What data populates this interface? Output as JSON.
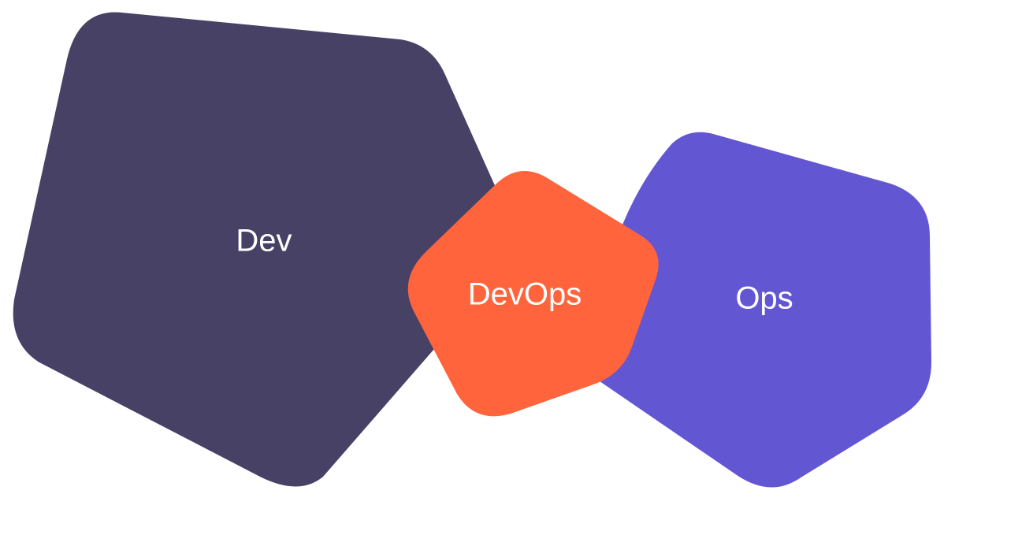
{
  "colors": {
    "background": "#ffffff",
    "dev": "#474166",
    "ops": "#6356d3",
    "devops": "#ff643c",
    "label": "#ffffff"
  },
  "shapes": {
    "dev": {
      "label": "Dev"
    },
    "ops": {
      "label": "Ops"
    },
    "devops": {
      "label": "DevOps"
    }
  }
}
